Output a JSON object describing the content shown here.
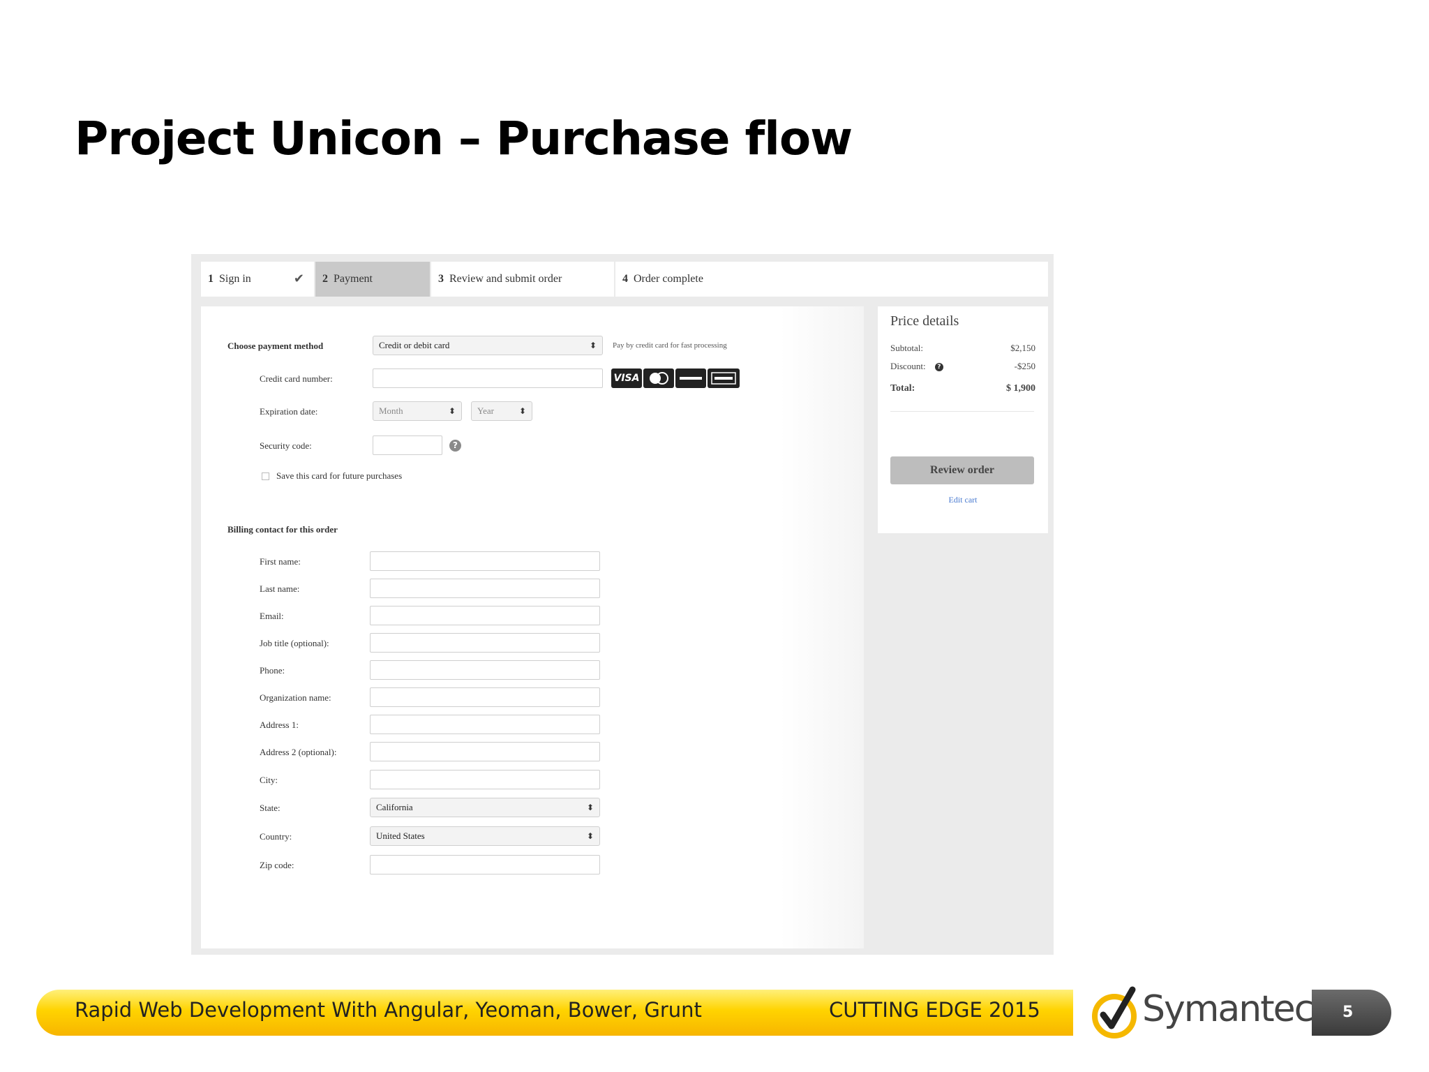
{
  "slide": {
    "title": "Project Unicon – Purchase flow",
    "page_number": "5"
  },
  "steps": [
    {
      "num": "1",
      "label": "Sign in",
      "done": true
    },
    {
      "num": "2",
      "label": "Payment",
      "active": true
    },
    {
      "num": "3",
      "label": "Review and submit order"
    },
    {
      "num": "4",
      "label": "Order complete"
    }
  ],
  "payment": {
    "method_label": "Choose payment method",
    "method_value": "Credit or debit card",
    "method_hint": "Pay by credit card for fast processing",
    "card_number_label": "Credit card number:",
    "expiration_label": "Expiration date:",
    "month_placeholder": "Month",
    "year_placeholder": "Year",
    "security_label": "Security code:",
    "save_card_label": "Save this card for future purchases",
    "cards": [
      "VISA",
      "MC",
      "DISC",
      "AMEX"
    ]
  },
  "billing": {
    "section_label": "Billing contact for this order",
    "first_name": "First name:",
    "last_name": "Last name:",
    "email": "Email:",
    "job_title": "Job title (optional):",
    "phone": "Phone:",
    "organization": "Organization name:",
    "address1": "Address 1:",
    "address2": "Address 2 (optional):",
    "city": "City:",
    "state": "State:",
    "state_value": "California",
    "country": "Country:",
    "country_value": "United States",
    "zip": "Zip code:"
  },
  "price": {
    "title": "Price details",
    "subtotal_label": "Subtotal:",
    "subtotal_value": "$2,150",
    "discount_label": "Discount:",
    "discount_value": "-$250",
    "total_label": "Total:",
    "total_value": "$ 1,900",
    "review_button": "Review order",
    "edit_cart": "Edit cart"
  },
  "footer": {
    "left_text": "Rapid Web Development With Angular, Yeoman, Bower, Grunt",
    "right_text": "CUTTING EDGE 2015",
    "logo_text": "Symantec."
  },
  "colors": {
    "footer_yellow": "#ffd300",
    "active_step": "#c9c9c9",
    "link_blue": "#4a7bd0"
  }
}
